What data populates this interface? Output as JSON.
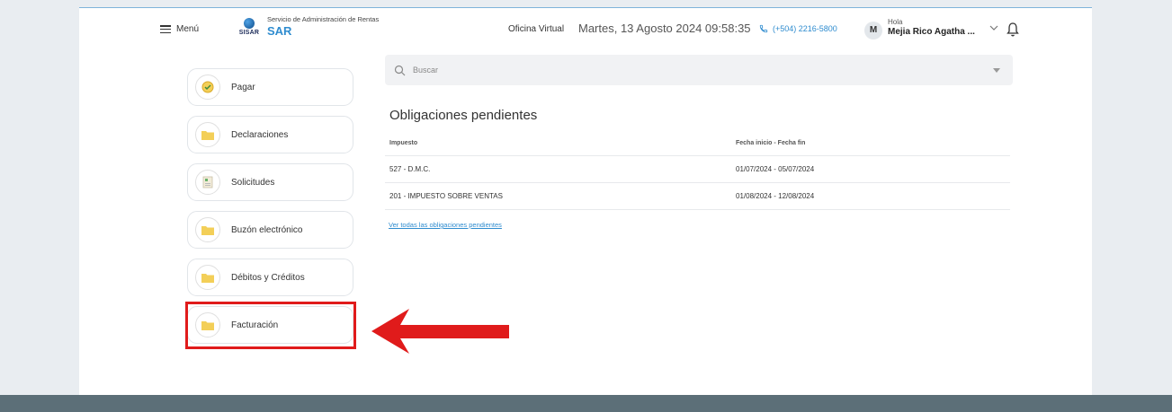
{
  "header": {
    "menu_label": "Menú",
    "logo_text": "SISAR",
    "brand_subtitle": "Servicio de Administración de Rentas",
    "brand_name": "SAR",
    "office_label": "Oficina Virtual",
    "datetime": "Martes, 13 Agosto 2024 09:58:35",
    "phone": "(+504) 2216-5800",
    "avatar_initial": "M",
    "greeting": "Hola",
    "user_name": "Mejia Rico Agatha ..."
  },
  "sidebar": {
    "items": [
      {
        "label": "Pagar",
        "icon": "coin-icon"
      },
      {
        "label": "Declaraciones",
        "icon": "folder-icon"
      },
      {
        "label": "Solicitudes",
        "icon": "document-icon"
      },
      {
        "label": "Buzón electrónico",
        "icon": "folder-icon"
      },
      {
        "label": "Débitos y Créditos",
        "icon": "folder-icon"
      },
      {
        "label": "Facturación",
        "icon": "folder-icon"
      }
    ]
  },
  "search": {
    "placeholder": "Buscar"
  },
  "obligations": {
    "title": "Obligaciones pendientes",
    "columns": [
      "Impuesto",
      "Fecha inicio - Fecha fin"
    ],
    "rows": [
      {
        "tax": "527 - D.M.C.",
        "period": "01/07/2024 - 05/07/2024"
      },
      {
        "tax": "201 - IMPUESTO SOBRE VENTAS",
        "period": "01/08/2024 - 12/08/2024"
      }
    ],
    "view_all_link": "Ver todas las obligaciones pendientes"
  },
  "colors": {
    "accent": "#2f8ccf",
    "highlight": "#e01b1b",
    "folder": "#f3cf58",
    "bottom_strip": "#5c6f78"
  }
}
